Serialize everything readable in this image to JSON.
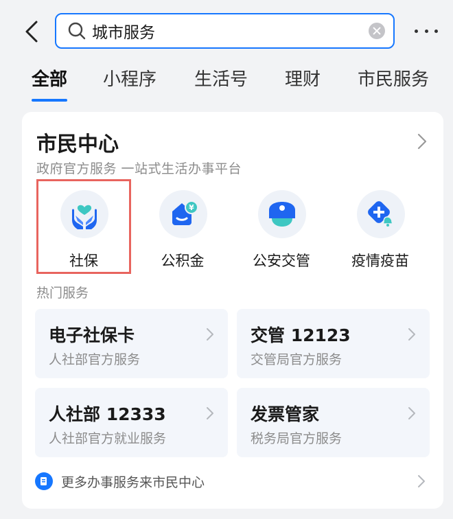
{
  "header": {
    "back_icon": "chevron-left-icon",
    "search": {
      "value": "城市服务",
      "search_icon": "search-icon",
      "clear_icon": "clear-icon"
    },
    "more_icon": "more-dots-icon"
  },
  "tabs": [
    {
      "label": "全部",
      "active": true
    },
    {
      "label": "小程序",
      "active": false
    },
    {
      "label": "生活号",
      "active": false
    },
    {
      "label": "理财",
      "active": false
    },
    {
      "label": "市民服务",
      "active": false
    }
  ],
  "card": {
    "title": "市民中心",
    "subtitle": "政府官方服务 一站式生活办事平台",
    "services": [
      {
        "label": "社保",
        "icon": "social-security-hands-heart-icon",
        "highlighted": true
      },
      {
        "label": "公积金",
        "icon": "housing-fund-house-yen-icon",
        "highlighted": false
      },
      {
        "label": "公安交管",
        "icon": "police-cap-icon",
        "highlighted": false
      },
      {
        "label": "疫情疫苗",
        "icon": "health-plus-bell-icon",
        "highlighted": false
      }
    ],
    "hot_label": "热门服务",
    "hot_services": [
      {
        "title": "电子社保卡",
        "subtitle": "人社部官方服务"
      },
      {
        "title": "交管 12123",
        "subtitle": "交管局官方服务"
      },
      {
        "title": "人社部 12333",
        "subtitle": "人社部官方就业服务"
      },
      {
        "title": "发票管家",
        "subtitle": "税务局官方服务"
      }
    ],
    "footer": {
      "text": "更多办事服务来市民中心",
      "icon": "document-icon"
    }
  },
  "colors": {
    "accent": "#1677ff",
    "highlight_border": "#e8645e",
    "background": "#f2f3f5",
    "muted_text": "#8c8c8c"
  }
}
